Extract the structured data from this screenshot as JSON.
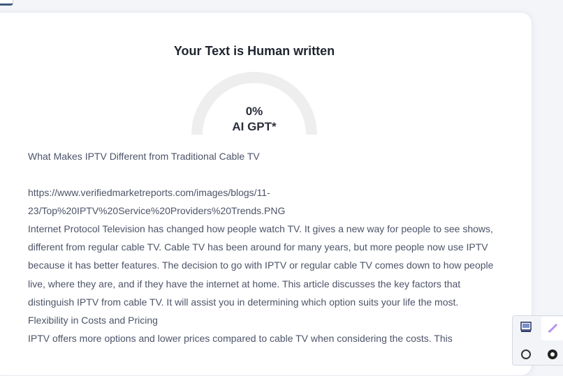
{
  "result": {
    "title": "Your Text is Human written",
    "gauge_value": "0%",
    "gauge_fraction": 0,
    "gauge_label": "AI GPT*"
  },
  "article": {
    "paragraphs": [
      "What Makes IPTV Different from Traditional Cable TV",
      "",
      "https://www.verifiedmarketreports.com/images/blogs/11-23/Top%20IPTV%20Service%20Providers%20Trends.PNG",
      "Internet Protocol Television has changed how people watch TV. It gives a new way for people to see shows, different from regular cable TV. Cable TV has been around for many years, but more people now use IPTV because it has better features. The decision to go with IPTV or regular cable TV comes down to how people live, where they are, and if they have the internet at home. This article discusses the key factors that distinguish IPTV from cable TV. It will assist you in determining which option suits your life the most.",
      "Flexibility in Costs and Pricing",
      "IPTV offers more options and lower prices compared to cable TV when considering the costs. This"
    ]
  },
  "toolbar": {
    "icons": [
      "screen-capture-icon",
      "pen-icon",
      "tool-icon",
      "grammar-icon"
    ]
  },
  "colors": {
    "gauge_track": "#eeeeee",
    "text": "#4d5468",
    "title": "#1f2430"
  }
}
